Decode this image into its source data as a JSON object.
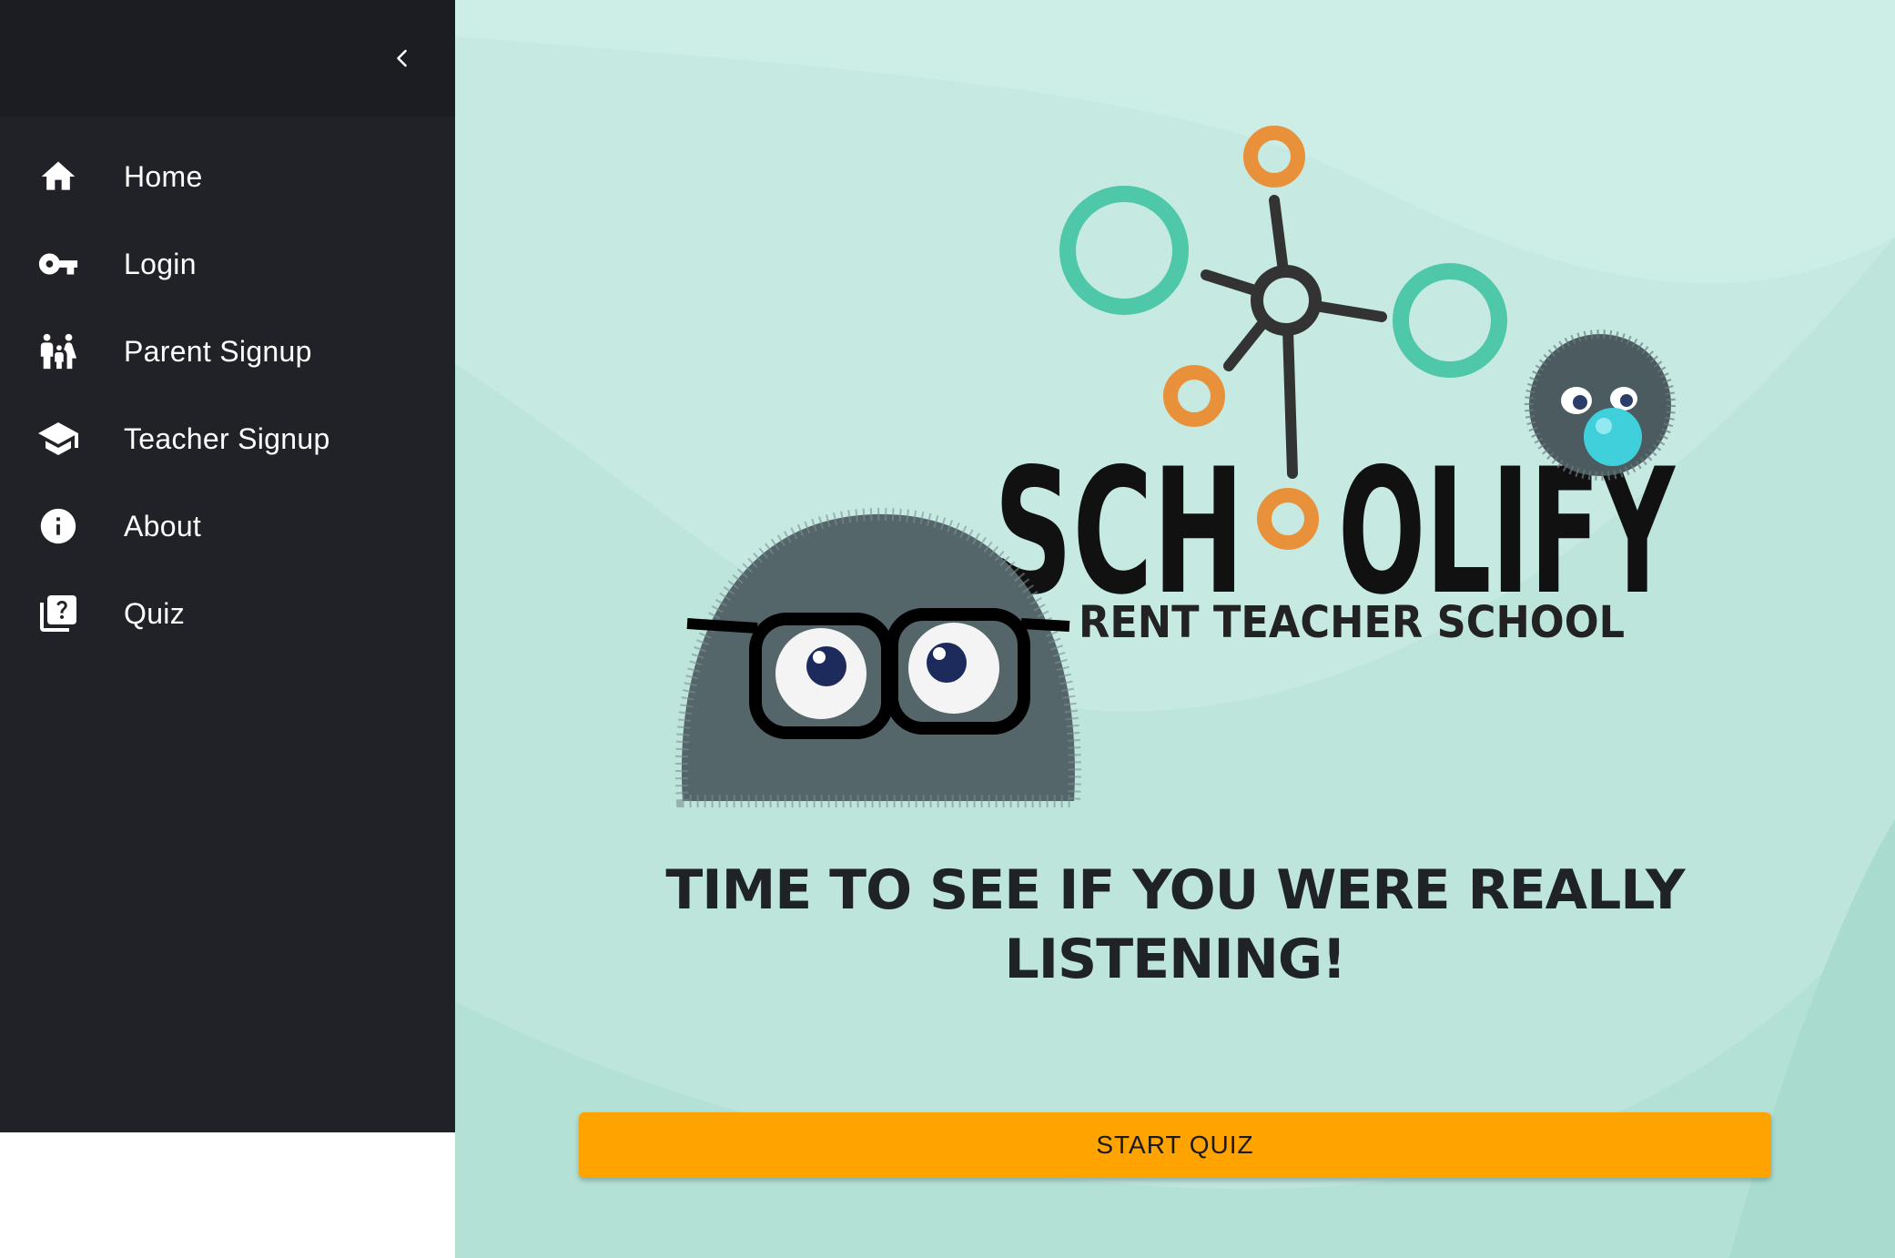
{
  "sidebar": {
    "collapse_icon": "chevron-left-icon",
    "items": [
      {
        "label": "Home",
        "icon": "home-icon"
      },
      {
        "label": "Login",
        "icon": "key-icon"
      },
      {
        "label": "Parent Signup",
        "icon": "family-icon"
      },
      {
        "label": "Teacher Signup",
        "icon": "graduation-cap-icon"
      },
      {
        "label": "About",
        "icon": "info-icon"
      },
      {
        "label": "Quiz",
        "icon": "quiz-icon"
      }
    ]
  },
  "logo": {
    "name_left": "SCH",
    "name_right": "OLIFY",
    "tagline": "RENT TEACHER SCHOOL"
  },
  "main": {
    "headline_line1": "TIME TO SEE IF YOU WERE REALLY",
    "headline_line2": "LISTENING!",
    "start_button": "START QUIZ"
  },
  "colors": {
    "sidebar_bg": "#212227",
    "main_bg": "#c3e8e0",
    "button": "#ffa300",
    "logo_teal": "#4ec8a8",
    "logo_orange": "#e8903a"
  }
}
